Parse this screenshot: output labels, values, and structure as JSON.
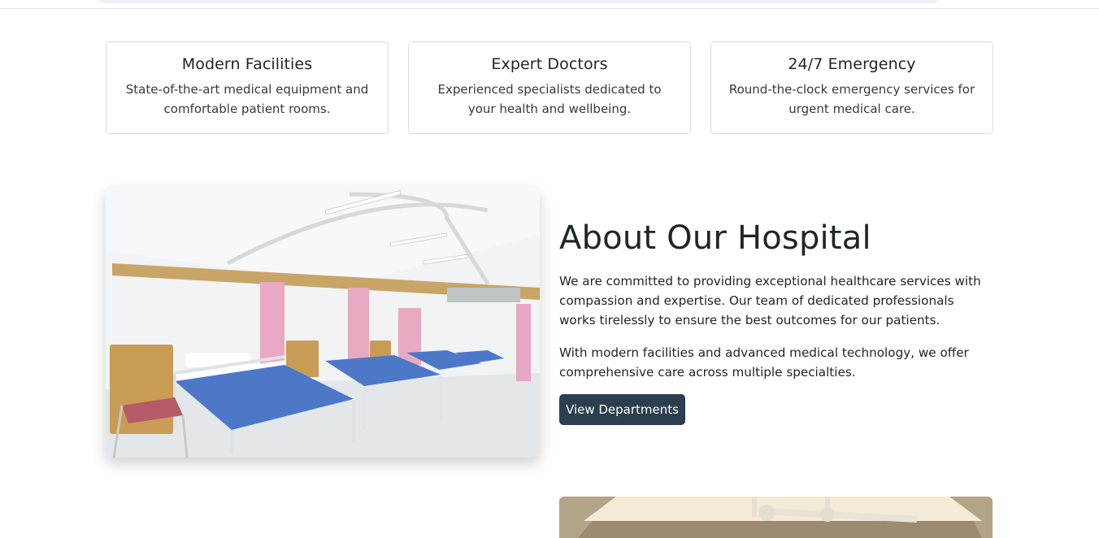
{
  "features": [
    {
      "title": "Modern Facilities",
      "text": "State-of-the-art medical equipment and comfortable patient rooms."
    },
    {
      "title": "Expert Doctors",
      "text": "Experienced specialists dedicated to your health and wellbeing."
    },
    {
      "title": "24/7 Emergency",
      "text": "Round-the-clock emergency services for urgent medical care."
    }
  ],
  "about": {
    "title": "About Our Hospital",
    "paragraph1": "We are committed to providing exceptional healthcare services with compassion and expertise. Our team of dedicated professionals works tirelessly to ensure the best outcomes for our patients.",
    "paragraph2": "With modern facilities and advanced medical technology, we offer comprehensive care across multiple specialties.",
    "button_label": "View Departments"
  },
  "colors": {
    "button_bg": "#2c3e50",
    "card_border": "#dadde1"
  }
}
